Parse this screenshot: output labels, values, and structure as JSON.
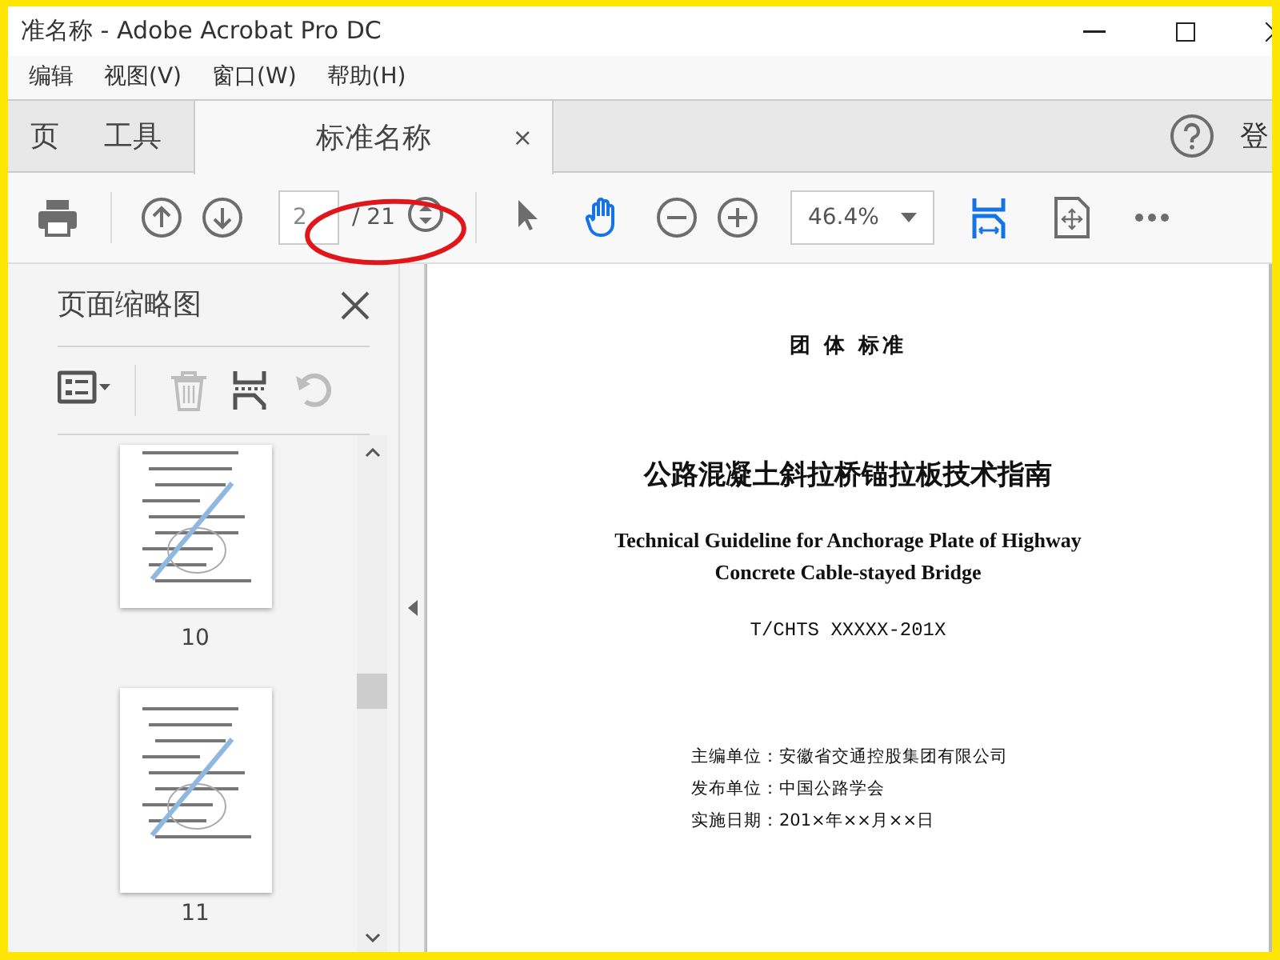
{
  "window": {
    "title": "准名称 - Adobe Acrobat Pro DC"
  },
  "menu": [
    {
      "label": "编辑"
    },
    {
      "label": "视图(V)"
    },
    {
      "label": "窗口(W)"
    },
    {
      "label": "帮助(H)"
    }
  ],
  "tabs": [
    {
      "label": "页",
      "kind": "home",
      "selected": false
    },
    {
      "label": "工具",
      "kind": "home",
      "selected": false
    },
    {
      "label": "标准名称",
      "kind": "document",
      "selected": true,
      "close": "×"
    }
  ],
  "account": {
    "label": "登"
  },
  "toolbar": {
    "buttons": [
      {
        "kind": "print",
        "selected": false
      },
      {
        "kind": "sep"
      },
      {
        "kind": "prev",
        "selected": false
      },
      {
        "kind": "next",
        "selected": false
      },
      {
        "kind": "page"
      },
      {
        "kind": "spin",
        "selected": false
      },
      {
        "kind": "sep"
      },
      {
        "kind": "select",
        "selected": false
      },
      {
        "kind": "hand",
        "selected": true
      },
      {
        "kind": "zoomout",
        "selected": false
      },
      {
        "kind": "zoomin",
        "selected": false
      },
      {
        "kind": "zoom"
      },
      {
        "kind": "fit",
        "selected": true
      },
      {
        "kind": "fullscreen",
        "selected": false
      },
      {
        "kind": "more",
        "selected": false
      }
    ],
    "page": "2",
    "page_count": "/ 21",
    "zoom": "46.4%"
  },
  "sidebar": {
    "title": "页面缩略图",
    "tools": [
      {
        "kind": "options",
        "disabled": false
      },
      {
        "kind": "sep"
      },
      {
        "kind": "trash",
        "disabled": true
      },
      {
        "kind": "insert",
        "disabled": false
      },
      {
        "kind": "rotate",
        "disabled": true
      }
    ],
    "thumbnails": [
      {
        "label": "10",
        "cut": true
      },
      {
        "label": "11",
        "cut": false
      }
    ]
  },
  "document": {
    "lines": [
      {
        "kind": "category",
        "text": "团 体 标准"
      },
      {
        "kind": "title",
        "text": "公路混凝土斜拉桥锚拉板技术指南"
      },
      {
        "kind": "english",
        "text": "Technical Guideline for Anchorage Plate of Highway"
      },
      {
        "kind": "english",
        "text": "Concrete Cable-stayed Bridge"
      },
      {
        "kind": "code",
        "text": "T/CHTS XXXXX-201X"
      }
    ],
    "info": [
      "主编单位：安徽省交通控股集团有限公司",
      "发布单位：中国公路学会",
      "实施日期：201×年××月××日"
    ]
  }
}
